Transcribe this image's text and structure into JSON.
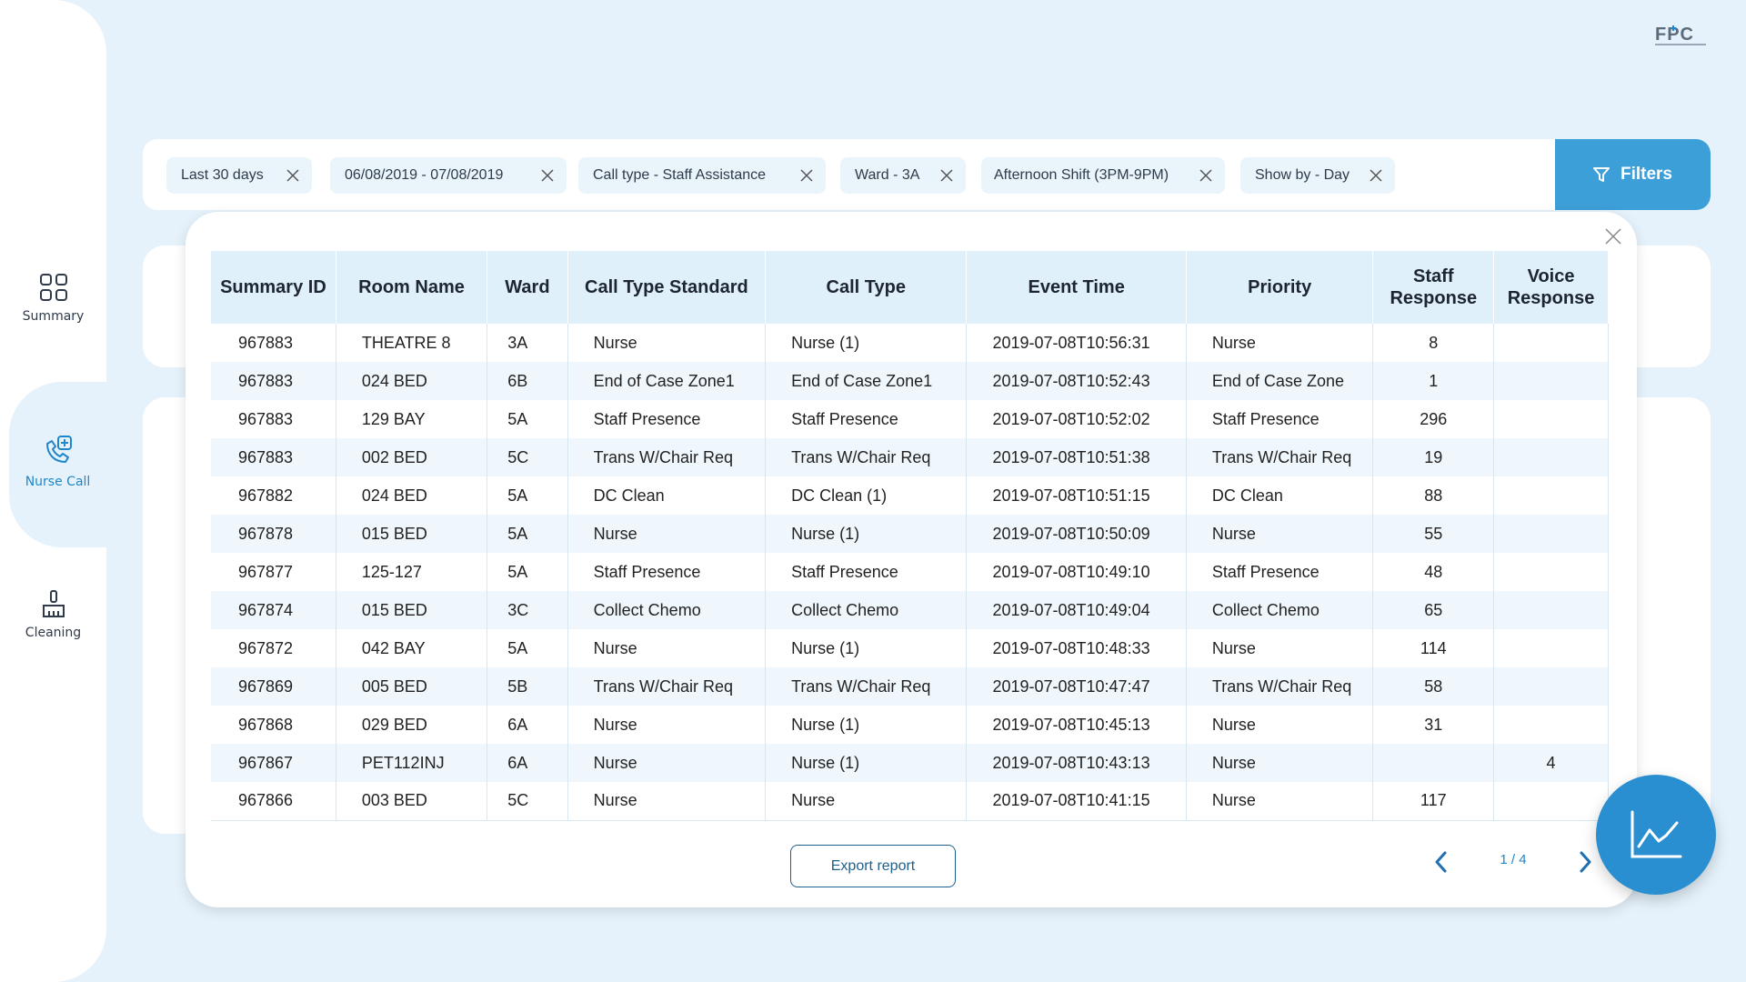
{
  "brand": {
    "logo_text": "FPC",
    "accent": "#1f86c9"
  },
  "sidebar": {
    "items": [
      {
        "label": "Summary",
        "icon": "grid-icon"
      },
      {
        "label": "Nurse Call",
        "icon": "phone-plus-icon"
      },
      {
        "label": "Cleaning",
        "icon": "broom-icon"
      }
    ]
  },
  "filters": {
    "chips": [
      "Last 30 days",
      "06/08/2019 - 07/08/2019",
      "Call type - Staff Assistance",
      "Ward - 3A",
      "Afternoon Shift (3PM-9PM)",
      "Show by - Day"
    ],
    "button_label": "Filters"
  },
  "table": {
    "headers": [
      "Summary ID",
      "Room Name",
      "Ward",
      "Call Type Standard",
      "Call Type",
      "Event Time",
      "Priority",
      "Staff Response",
      "Voice Response"
    ],
    "rows": [
      [
        "967883",
        "THEATRE 8",
        "3A",
        "Nurse",
        "Nurse (1)",
        "2019-07-08T10:56:31",
        "Nurse",
        "8",
        ""
      ],
      [
        "967883",
        "024 BED",
        "6B",
        "End of Case Zone1",
        "End of Case Zone1",
        "2019-07-08T10:52:43",
        "End of Case Zone",
        "1",
        ""
      ],
      [
        "967883",
        "129 BAY",
        "5A",
        "Staff Presence",
        "Staff Presence",
        "2019-07-08T10:52:02",
        "Staff Presence",
        "296",
        ""
      ],
      [
        "967883",
        "002 BED",
        "5C",
        "Trans W/Chair Req",
        "Trans W/Chair Req",
        "2019-07-08T10:51:38",
        "Trans W/Chair Req",
        "19",
        ""
      ],
      [
        "967882",
        "024 BED",
        "5A",
        "DC Clean",
        "DC Clean (1)",
        "2019-07-08T10:51:15",
        "DC Clean",
        "88",
        ""
      ],
      [
        "967878",
        "015 BED",
        "5A",
        "Nurse",
        "Nurse (1)",
        "2019-07-08T10:50:09",
        "Nurse",
        "55",
        ""
      ],
      [
        "967877",
        "125-127",
        "5A",
        "Staff Presence",
        "Staff Presence",
        "2019-07-08T10:49:10",
        "Staff Presence",
        "48",
        ""
      ],
      [
        "967874",
        "015 BED",
        "3C",
        "Collect Chemo",
        "Collect Chemo",
        "2019-07-08T10:49:04",
        "Collect Chemo",
        "65",
        ""
      ],
      [
        "967872",
        "042 BAY",
        "5A",
        "Nurse",
        "Nurse (1)",
        "2019-07-08T10:48:33",
        "Nurse",
        "114",
        ""
      ],
      [
        "967869",
        "005 BED",
        "5B",
        "Trans W/Chair Req",
        "Trans W/Chair Req",
        "2019-07-08T10:47:47",
        "Trans W/Chair Req",
        "58",
        ""
      ],
      [
        "967868",
        "029 BED",
        "6A",
        "Nurse",
        "Nurse (1)",
        "2019-07-08T10:45:13",
        "Nurse",
        "31",
        ""
      ],
      [
        "967867",
        "PET112INJ",
        "6A",
        "Nurse",
        "Nurse (1)",
        "2019-07-08T10:43:13",
        "Nurse",
        "",
        "4"
      ],
      [
        "967866",
        "003 BED",
        "5C",
        "Nurse",
        "Nurse",
        "2019-07-08T10:41:15",
        "Nurse",
        "117",
        ""
      ]
    ]
  },
  "footer": {
    "export_label": "Export report",
    "page_indicator": "1 / 4"
  }
}
